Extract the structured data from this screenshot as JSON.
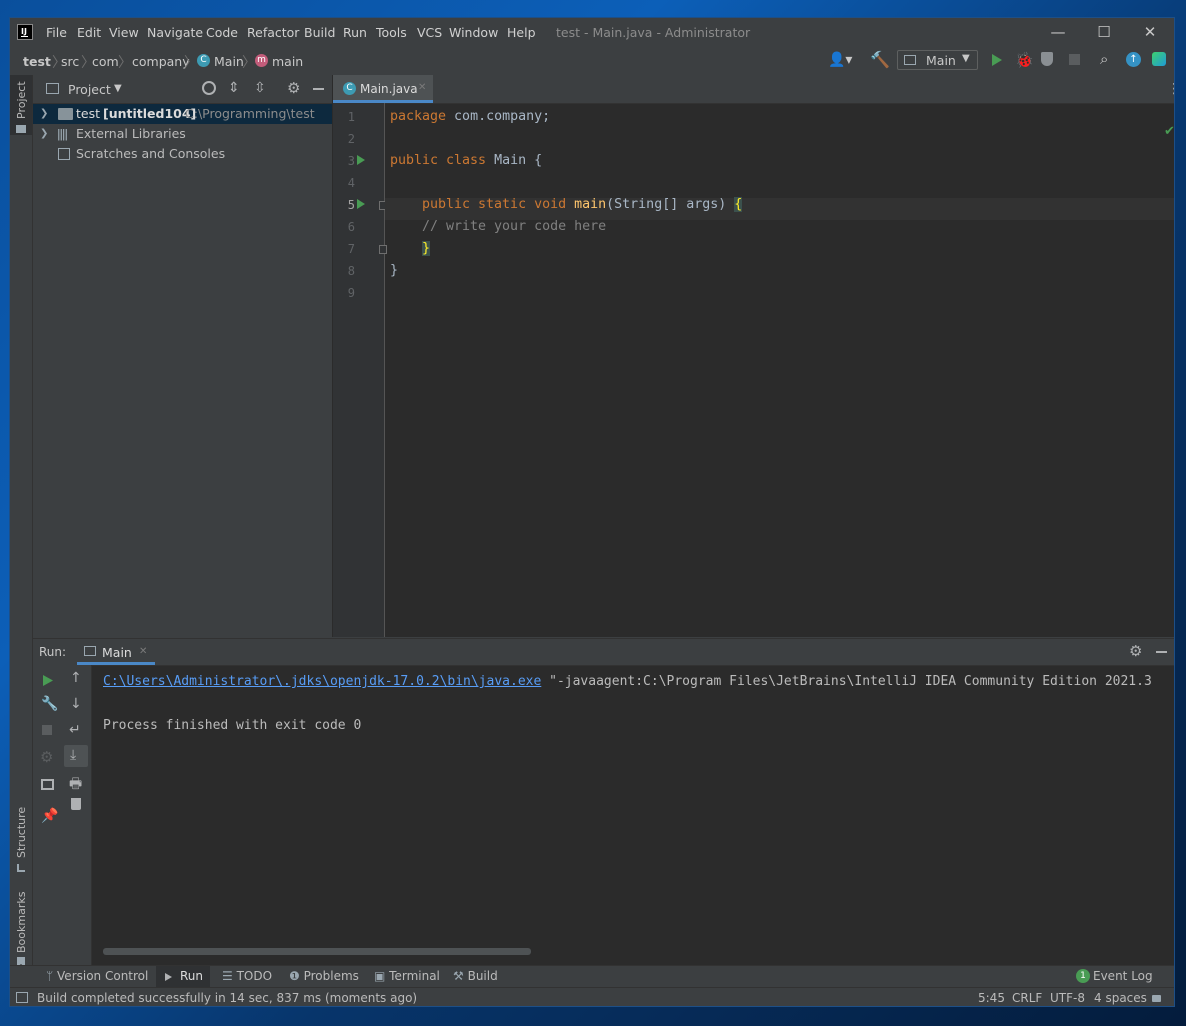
{
  "window": {
    "title": "test - Main.java - Administrator",
    "min_icon": "—",
    "max_icon": "☐",
    "close_icon": "✕"
  },
  "menu": [
    "File",
    "Edit",
    "View",
    "Navigate",
    "Code",
    "Refactor",
    "Build",
    "Run",
    "Tools",
    "VCS",
    "Window",
    "Help"
  ],
  "breadcrumb": [
    "test",
    "src",
    "com",
    "company",
    "Main",
    "main"
  ],
  "toolbar": {
    "run_config": "Main"
  },
  "left_strip": {
    "project": "Project",
    "structure": "Structure",
    "bookmarks": "Bookmarks"
  },
  "project_panel": {
    "title": "Project",
    "tree": [
      {
        "name": "test",
        "extra": "[untitled104]",
        "path": "C:\\Programming\\test"
      },
      {
        "name": "External Libraries"
      },
      {
        "name": "Scratches and Consoles"
      }
    ]
  },
  "editor": {
    "tab": "Main.java",
    "line_numbers": [
      "1",
      "2",
      "3",
      "4",
      "5",
      "6",
      "7",
      "8",
      "9"
    ],
    "lines": {
      "l1_kw": "package",
      "l1_rest": " com.company;",
      "l3_kw": "public class",
      "l3_rest": " Main {",
      "l5_kw": "public static void",
      "l5_fn": "main",
      "l5_rest": "(String[] args) ",
      "l5_brace": "{",
      "l6": "// write your code here",
      "l7": "}",
      "l8": "}"
    }
  },
  "run_panel": {
    "label": "Run:",
    "tab": "Main",
    "console_path": "C:\\Users\\Administrator\\.jdks\\openjdk-17.0.2\\bin\\java.exe",
    "console_args": " \"-javaagent:C:\\Program Files\\JetBrains\\IntelliJ IDEA Community Edition 2021.3",
    "console_exit": "Process finished with exit code 0"
  },
  "tool_windows": [
    "Version Control",
    "Run",
    "TODO",
    "Problems",
    "Terminal",
    "Build"
  ],
  "event_log": {
    "count": "1",
    "label": "Event Log"
  },
  "status": {
    "message": "Build completed successfully in 14 sec, 837 ms (moments ago)",
    "position": "5:45",
    "line_sep": "CRLF",
    "encoding": "UTF-8",
    "indent": "4 spaces"
  }
}
